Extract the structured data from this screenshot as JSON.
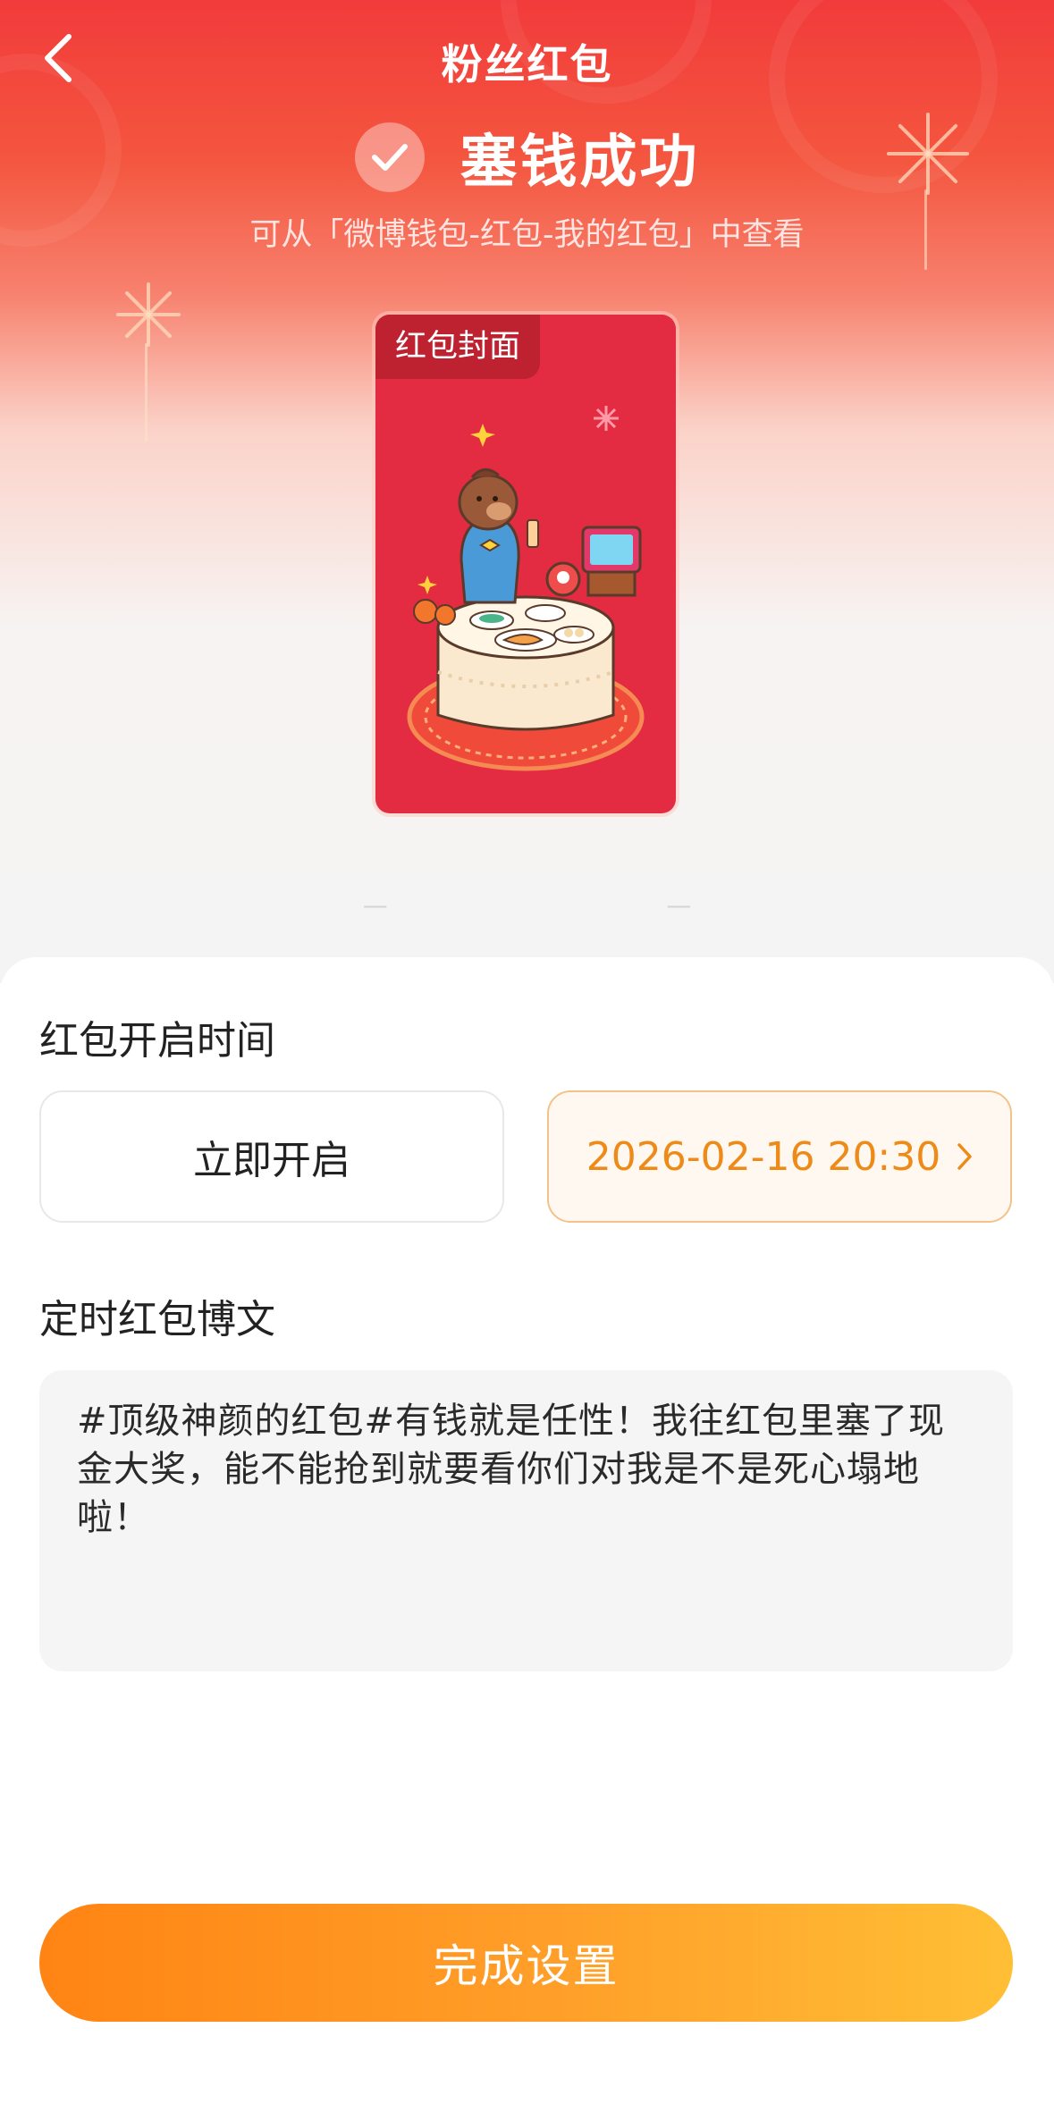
{
  "header": {
    "title": "粉丝红包",
    "back_icon": "chevron-left-icon"
  },
  "success": {
    "title": "塞钱成功",
    "icon": "check-icon",
    "hint": "可从「微博钱包-红包-我的红包」中查看"
  },
  "cover": {
    "label": "红包封面"
  },
  "open_time": {
    "title": "红包开启时间",
    "options": [
      {
        "label": "立即开启",
        "selected": false
      },
      {
        "label": "2026-02-16 20:30",
        "selected": true
      }
    ]
  },
  "post": {
    "title": "定时红包博文",
    "content": "#顶级神颜的红包#有钱就是任性！我往红包里塞了现金大奖，能不能抢到就要看你们对我是不是死心塌地啦！"
  },
  "footer": {
    "done_label": "完成设置"
  },
  "colors": {
    "brand_red": "#e32b41",
    "accent_orange": "#ee8a17",
    "button_gradient_start": "#ff8413",
    "button_gradient_end": "#ffbf35"
  }
}
